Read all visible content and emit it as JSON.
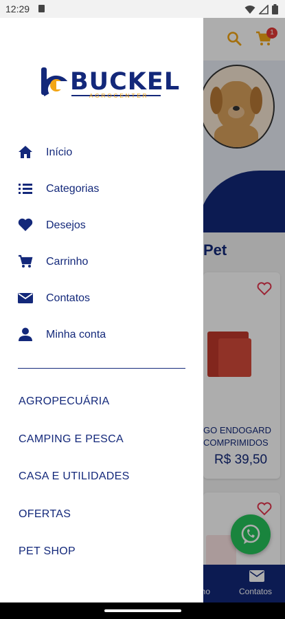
{
  "status_bar": {
    "time": "12:29"
  },
  "header": {
    "cart_count": "1"
  },
  "background": {
    "section_title": "Pet",
    "product_name_line1": "GO ENDOGARD",
    "product_name_line2": "COMPRIMIDOS",
    "product_price": "R$  39,50",
    "nav_label_partial": "nho",
    "nav_label_contatos": "Contatos"
  },
  "drawer": {
    "logo": {
      "word": "BUCKEL",
      "sub": "AGROCENTER"
    },
    "menu": [
      {
        "label": "Início",
        "icon": "home-icon"
      },
      {
        "label": "Categorias",
        "icon": "list-icon"
      },
      {
        "label": "Desejos",
        "icon": "heart-icon"
      },
      {
        "label": "Carrinho",
        "icon": "cart-icon"
      },
      {
        "label": "Contatos",
        "icon": "mail-icon"
      },
      {
        "label": "Minha conta",
        "icon": "person-icon"
      }
    ],
    "categories": [
      {
        "label": "AGROPECUÁRIA"
      },
      {
        "label": "CAMPING E PESCA"
      },
      {
        "label": "CASA E UTILIDADES"
      },
      {
        "label": "OFERTAS"
      },
      {
        "label": "PET SHOP"
      }
    ]
  },
  "colors": {
    "brand_blue": "#13287a",
    "accent_yellow": "#f2a515",
    "whatsapp_green": "#26c35a"
  }
}
